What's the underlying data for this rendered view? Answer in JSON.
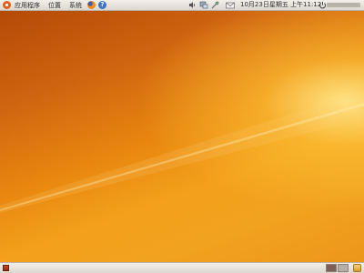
{
  "top_panel": {
    "menus": [
      {
        "label": "应用程序"
      },
      {
        "label": "位置"
      },
      {
        "label": "系统"
      }
    ],
    "launchers": [
      {
        "icon": "firefox-icon"
      },
      {
        "icon": "help-icon",
        "glyph": "?"
      }
    ],
    "tray_icons": [
      "volume-icon",
      "network-icon",
      "update-icon",
      "mail-icon"
    ],
    "clock": "10月23日星期五 上午11:12",
    "power_icon": "power-icon"
  },
  "bottom_panel": {
    "show_desktop_icon": "show-desktop-icon",
    "workspaces": [
      {
        "color": "#7d5f55",
        "active": true
      },
      {
        "color": "#b7aea6",
        "active": false
      },
      {
        "color": "#b7aea6",
        "active": false
      }
    ],
    "trash_icon": "trash-icon"
  },
  "colors": {
    "panel": "#e6e2db",
    "wallpaper_dark": "#b44a07",
    "wallpaper_light": "#f3a01c"
  }
}
